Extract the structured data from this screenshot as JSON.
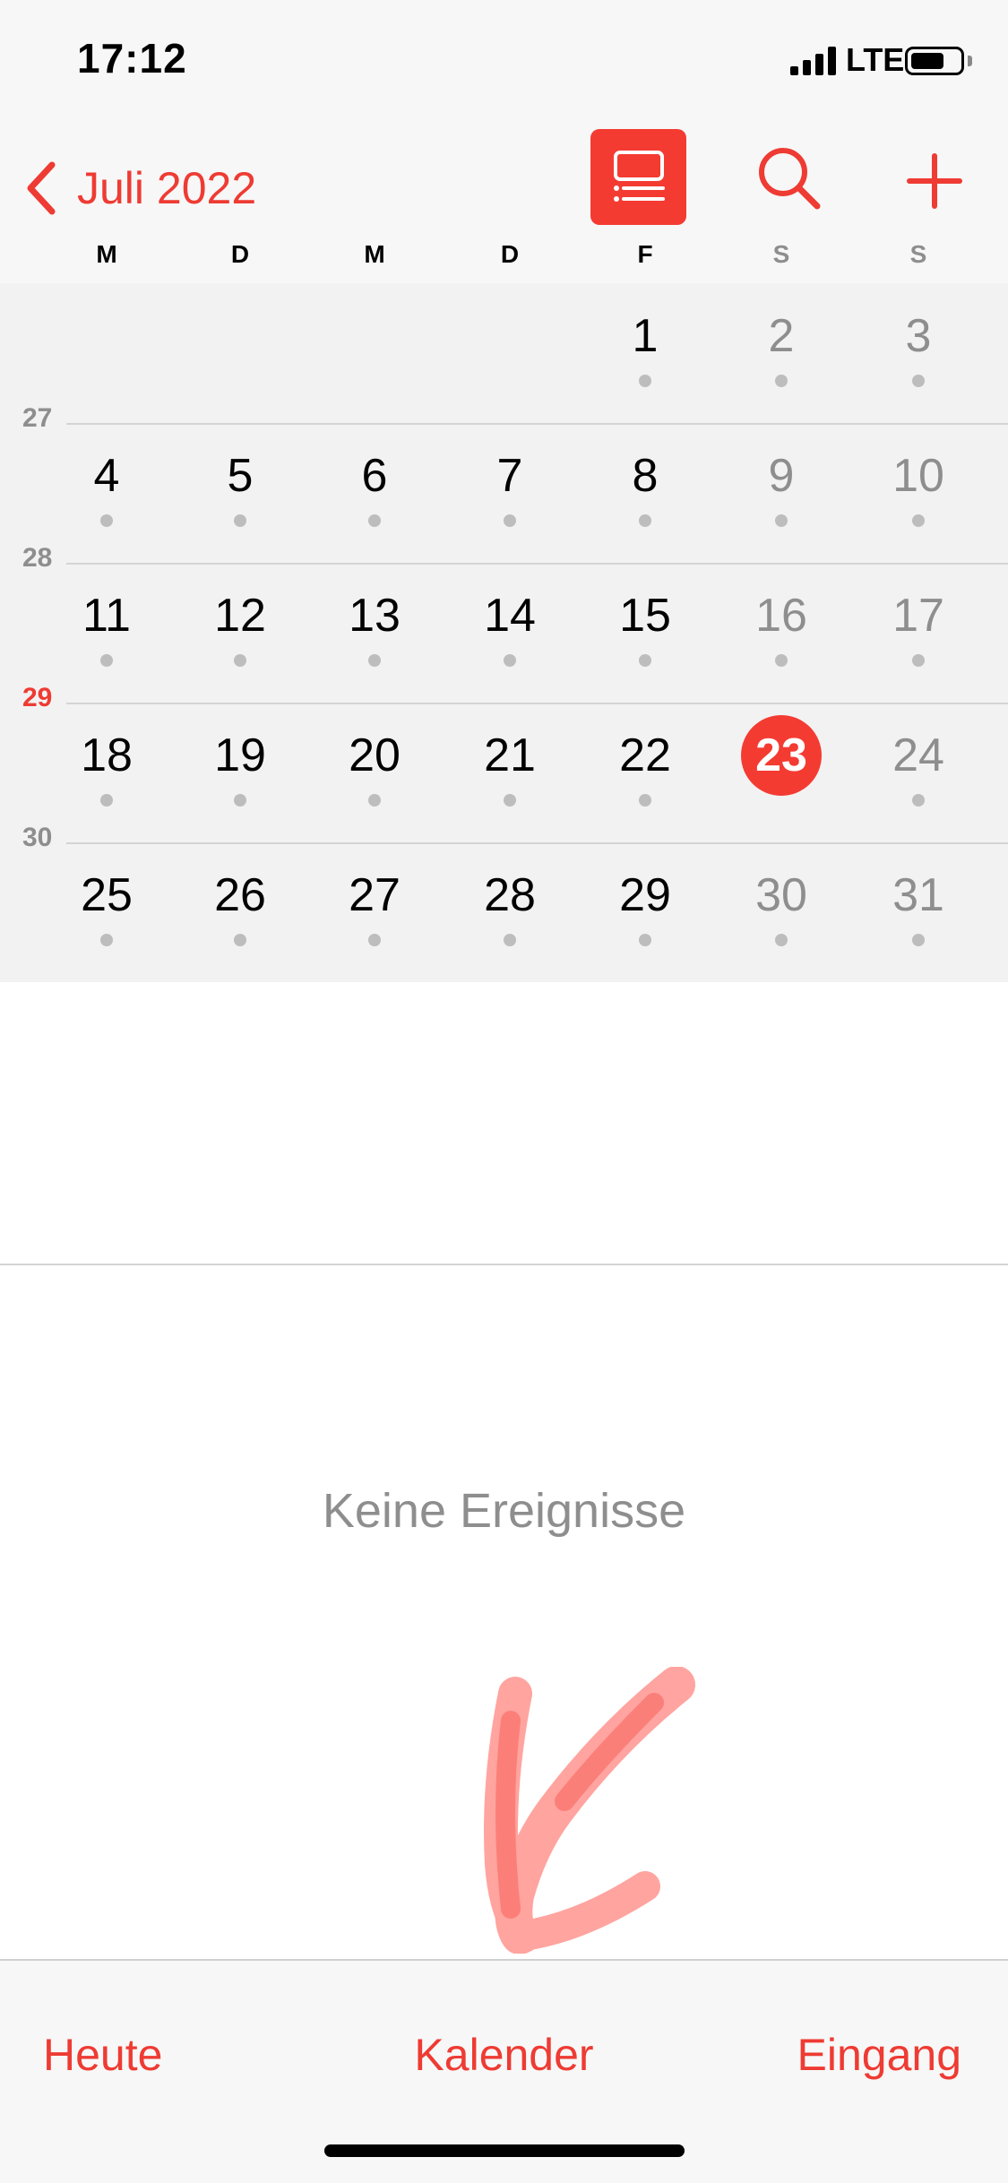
{
  "status_bar": {
    "time": "17:12",
    "network": "LTE",
    "battery_level": 0.7
  },
  "header": {
    "back_label": "Juli 2022"
  },
  "weekdays": [
    {
      "label": "M",
      "weekend": false
    },
    {
      "label": "D",
      "weekend": false
    },
    {
      "label": "M",
      "weekend": false
    },
    {
      "label": "D",
      "weekend": false
    },
    {
      "label": "F",
      "weekend": false
    },
    {
      "label": "S",
      "weekend": true
    },
    {
      "label": "S",
      "weekend": true
    }
  ],
  "weeks": [
    {
      "number": "",
      "current": false,
      "days": [
        "",
        "",
        "",
        "",
        "1",
        "2",
        "3"
      ]
    },
    {
      "number": "27",
      "current": false,
      "days": [
        "4",
        "5",
        "6",
        "7",
        "8",
        "9",
        "10"
      ]
    },
    {
      "number": "28",
      "current": false,
      "days": [
        "11",
        "12",
        "13",
        "14",
        "15",
        "16",
        "17"
      ]
    },
    {
      "number": "29",
      "current": true,
      "days": [
        "18",
        "19",
        "20",
        "21",
        "22",
        "23",
        "24"
      ]
    },
    {
      "number": "30",
      "current": false,
      "days": [
        "25",
        "26",
        "27",
        "28",
        "29",
        "30",
        "31"
      ]
    }
  ],
  "today": "23",
  "empty_message": "Keine Ereignisse",
  "tabs": {
    "today": "Heute",
    "calendars": "Kalender",
    "inbox": "Eingang"
  },
  "colors": {
    "accent": "#ee3b33",
    "muted": "#8e8e8e",
    "grid_bg": "#f2f2f2"
  }
}
